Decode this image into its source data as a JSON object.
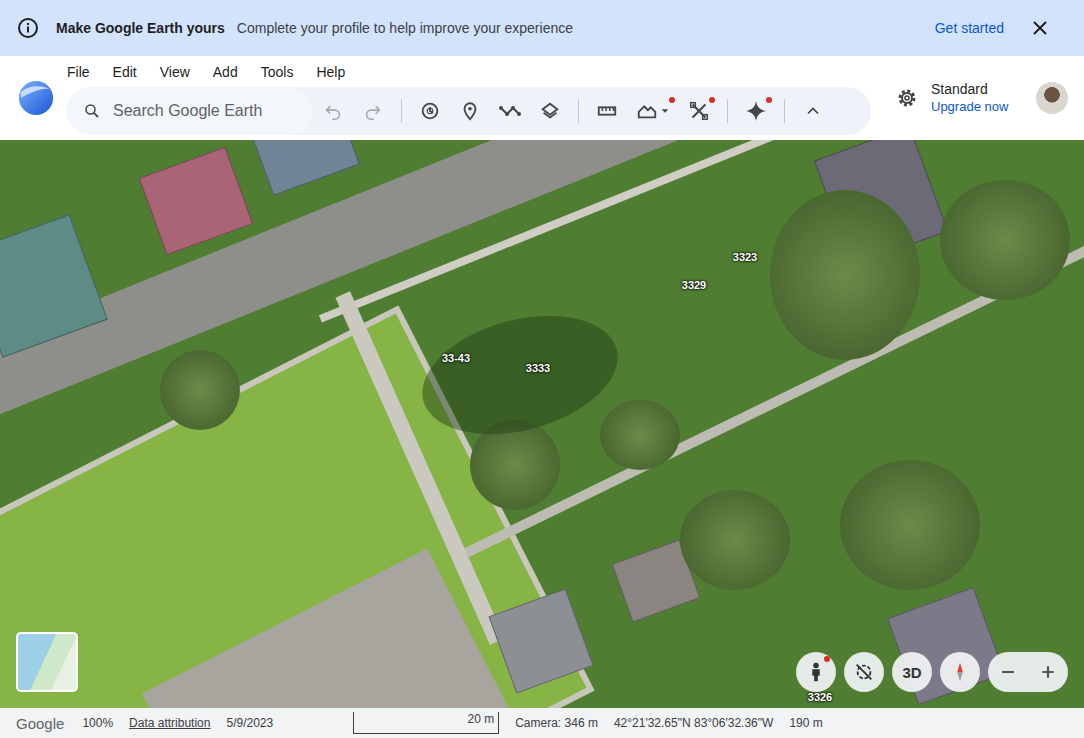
{
  "banner": {
    "title": "Make Google Earth yours",
    "message": "Complete your profile to help improve your experience",
    "action": "Get started"
  },
  "menu": [
    "File",
    "Edit",
    "View",
    "Add",
    "Tools",
    "Help"
  ],
  "search": {
    "placeholder": "Search Google Earth"
  },
  "toolbar": [
    {
      "kind": "undo",
      "disabled": true,
      "badge": false
    },
    {
      "kind": "redo",
      "disabled": true,
      "badge": false
    },
    {
      "kind": "history",
      "disabled": false,
      "badge": false
    },
    {
      "kind": "pin",
      "disabled": false,
      "badge": false
    },
    {
      "kind": "path",
      "disabled": false,
      "badge": false
    },
    {
      "kind": "layers",
      "disabled": false,
      "badge": false
    },
    {
      "kind": "ruler",
      "disabled": false,
      "badge": false
    },
    {
      "kind": "terrain",
      "disabled": false,
      "badge": true
    },
    {
      "kind": "tools",
      "disabled": false,
      "badge": true
    },
    {
      "kind": "gemini",
      "disabled": false,
      "badge": true
    },
    {
      "kind": "collapse",
      "disabled": false,
      "badge": false
    }
  ],
  "account": {
    "plan": "Standard",
    "upgrade": "Upgrade now"
  },
  "map_labels": [
    "3323",
    "3329",
    "33-43",
    "3333",
    "3326"
  ],
  "controls": [
    {
      "kind": "street-view",
      "badge": true,
      "label": ""
    },
    {
      "kind": "tilt-off",
      "badge": false,
      "label": ""
    },
    {
      "kind": "mode",
      "badge": false,
      "label": "3D"
    },
    {
      "kind": "compass",
      "badge": false,
      "label": ""
    }
  ],
  "status_bar": {
    "brand": "Google",
    "zoom": "100%",
    "attribution": "Data attribution",
    "date": "5/9/2023",
    "scale": "20 m",
    "camera": "Camera: 346 m",
    "coordinates": "42°21'32.65\"N 83°06'32.36\"W",
    "elevation": "190 m"
  }
}
